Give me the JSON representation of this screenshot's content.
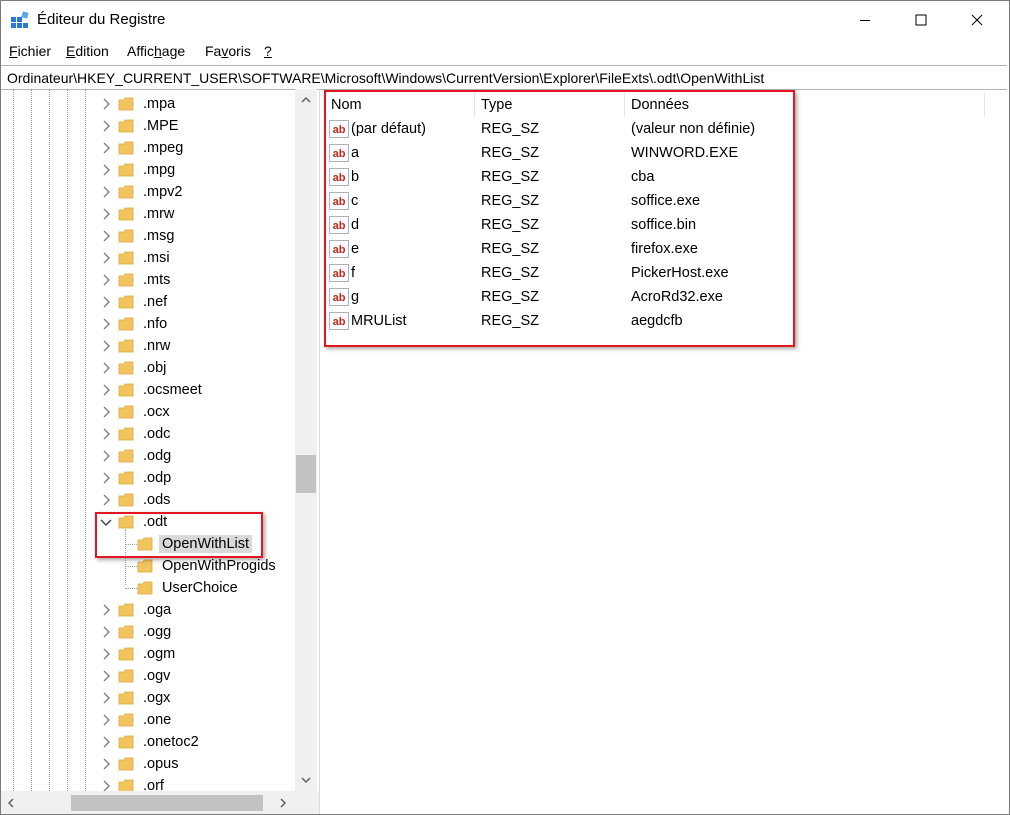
{
  "window": {
    "title": "Éditeur du Registre"
  },
  "menu": [
    {
      "label": "Fichier",
      "accel_index": 0
    },
    {
      "label": "Edition",
      "accel_index": 0
    },
    {
      "label": "Affichage",
      "accel_index": 5
    },
    {
      "label": "Favoris",
      "accel_index": 2
    },
    {
      "label": "?",
      "accel_index": 0
    }
  ],
  "address": "Ordinateur\\HKEY_CURRENT_USER\\SOFTWARE\\Microsoft\\Windows\\CurrentVersion\\Explorer\\FileExts\\.odt\\OpenWithList",
  "tree": {
    "items": [
      {
        "label": ".mpa",
        "level": 0,
        "state": "collapsed"
      },
      {
        "label": ".MPE",
        "level": 0,
        "state": "collapsed"
      },
      {
        "label": ".mpeg",
        "level": 0,
        "state": "collapsed"
      },
      {
        "label": ".mpg",
        "level": 0,
        "state": "collapsed"
      },
      {
        "label": ".mpv2",
        "level": 0,
        "state": "collapsed"
      },
      {
        "label": ".mrw",
        "level": 0,
        "state": "collapsed"
      },
      {
        "label": ".msg",
        "level": 0,
        "state": "collapsed"
      },
      {
        "label": ".msi",
        "level": 0,
        "state": "collapsed"
      },
      {
        "label": ".mts",
        "level": 0,
        "state": "collapsed"
      },
      {
        "label": ".nef",
        "level": 0,
        "state": "collapsed"
      },
      {
        "label": ".nfo",
        "level": 0,
        "state": "collapsed"
      },
      {
        "label": ".nrw",
        "level": 0,
        "state": "collapsed"
      },
      {
        "label": ".obj",
        "level": 0,
        "state": "collapsed"
      },
      {
        "label": ".ocsmeet",
        "level": 0,
        "state": "collapsed"
      },
      {
        "label": ".ocx",
        "level": 0,
        "state": "collapsed"
      },
      {
        "label": ".odc",
        "level": 0,
        "state": "collapsed"
      },
      {
        "label": ".odg",
        "level": 0,
        "state": "collapsed"
      },
      {
        "label": ".odp",
        "level": 0,
        "state": "collapsed"
      },
      {
        "label": ".ods",
        "level": 0,
        "state": "collapsed"
      },
      {
        "label": ".odt",
        "level": 0,
        "state": "expanded"
      },
      {
        "label": "OpenWithList",
        "level": 1,
        "state": "leaf",
        "selected": true
      },
      {
        "label": "OpenWithProgids",
        "level": 1,
        "state": "leaf"
      },
      {
        "label": "UserChoice",
        "level": 1,
        "state": "leaf"
      },
      {
        "label": ".oga",
        "level": 0,
        "state": "collapsed"
      },
      {
        "label": ".ogg",
        "level": 0,
        "state": "collapsed"
      },
      {
        "label": ".ogm",
        "level": 0,
        "state": "collapsed"
      },
      {
        "label": ".ogv",
        "level": 0,
        "state": "collapsed"
      },
      {
        "label": ".ogx",
        "level": 0,
        "state": "collapsed"
      },
      {
        "label": ".one",
        "level": 0,
        "state": "collapsed"
      },
      {
        "label": ".onetoc2",
        "level": 0,
        "state": "collapsed"
      },
      {
        "label": ".opus",
        "level": 0,
        "state": "collapsed"
      },
      {
        "label": ".orf",
        "level": 0,
        "state": "collapsed"
      }
    ]
  },
  "list": {
    "columns": [
      "Nom",
      "Type",
      "Données"
    ],
    "rows": [
      {
        "name": "(par défaut)",
        "type": "REG_SZ",
        "data": "(valeur non définie)"
      },
      {
        "name": "a",
        "type": "REG_SZ",
        "data": "WINWORD.EXE"
      },
      {
        "name": "b",
        "type": "REG_SZ",
        "data": "cba"
      },
      {
        "name": "c",
        "type": "REG_SZ",
        "data": "soffice.exe"
      },
      {
        "name": "d",
        "type": "REG_SZ",
        "data": "soffice.bin"
      },
      {
        "name": "e",
        "type": "REG_SZ",
        "data": "firefox.exe"
      },
      {
        "name": "f",
        "type": "REG_SZ",
        "data": "PickerHost.exe"
      },
      {
        "name": "g",
        "type": "REG_SZ",
        "data": "AcroRd32.exe"
      },
      {
        "name": "MRUList",
        "type": "REG_SZ",
        "data": "aegdcfb"
      }
    ]
  },
  "colors": {
    "highlight": "#e3171f",
    "folder": "#f2c55c",
    "selection": "#d9d9d9"
  },
  "icons": {
    "value": "string-value-icon",
    "key": "folder-icon",
    "app": "registry-editor-icon"
  }
}
